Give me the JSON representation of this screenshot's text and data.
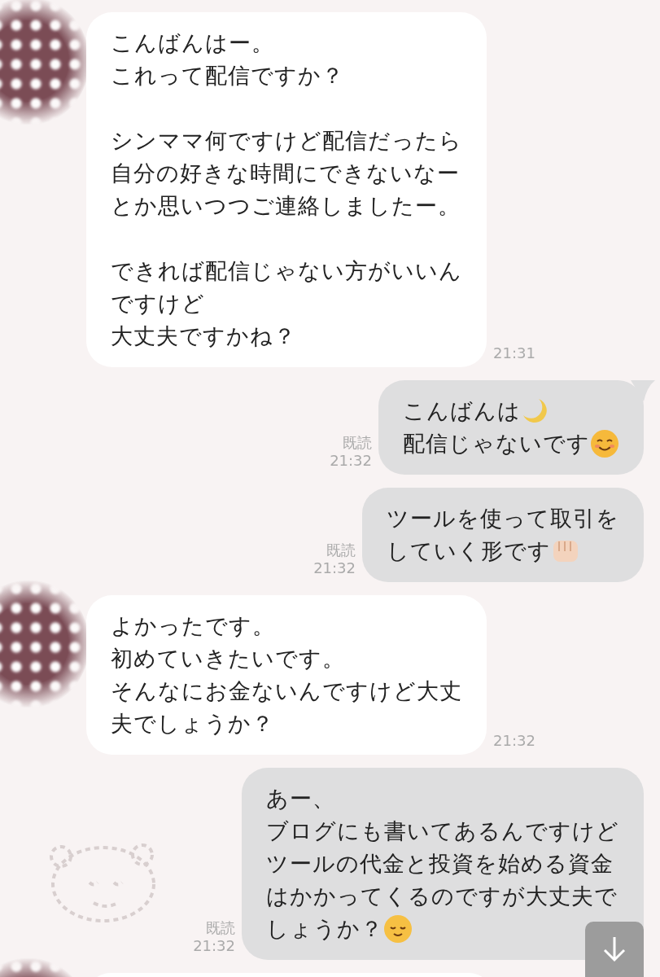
{
  "messages": [
    {
      "kind": "incoming",
      "time": "21:31",
      "paragraphs": [
        [
          {
            "kind": "plain",
            "text": "こんばんはー。"
          },
          {
            "kind": "plain",
            "text": "これって配信ですか？"
          }
        ],
        [
          {
            "kind": "plain",
            "text": "シンママ何ですけど配信だったら"
          },
          {
            "kind": "plain",
            "text": "自分の好きな時間にできないなー"
          },
          {
            "kind": "plain",
            "text": "とか思いつつご連絡しましたー。"
          }
        ],
        [
          {
            "kind": "plain",
            "text": "できれば配信じゃない方がいいん"
          },
          {
            "kind": "plain",
            "text": "ですけど"
          },
          {
            "kind": "plain",
            "text": "大丈夫ですかね？"
          }
        ]
      ]
    },
    {
      "kind": "outgoing",
      "tail": true,
      "read_label": "既読",
      "time": "21:32",
      "paragraphs": [
        [
          {
            "kind": "moon",
            "text": "こんばんは"
          },
          {
            "kind": "smile",
            "text": "配信じゃないです"
          }
        ]
      ]
    },
    {
      "kind": "outgoing",
      "tail": false,
      "read_label": "既読",
      "time": "21:32",
      "paragraphs": [
        [
          {
            "kind": "plain",
            "text": "ツールを使って取引を"
          },
          {
            "kind": "fist",
            "text": "していく形です"
          }
        ]
      ]
    },
    {
      "kind": "incoming",
      "time": "21:32",
      "paragraphs": [
        [
          {
            "kind": "plain",
            "text": "よかったです。"
          },
          {
            "kind": "plain",
            "text": "初めていきたいです。"
          },
          {
            "kind": "plain",
            "text": "そんなにお金ないんですけど大丈"
          },
          {
            "kind": "plain",
            "text": "夫でしょうか？"
          }
        ]
      ]
    },
    {
      "kind": "outgoing",
      "tail": false,
      "sticker": true,
      "read_label": "既読",
      "time": "21:32",
      "paragraphs": [
        [
          {
            "kind": "plain",
            "text": "あー、"
          },
          {
            "kind": "plain",
            "text": "ブログにも書いてあるんですけど"
          },
          {
            "kind": "plain",
            "text": "ツールの代金と投資を始める資金"
          },
          {
            "kind": "plain",
            "text": "はかかってくるのですが大丈夫で"
          },
          {
            "kind": "relieved",
            "text": "しょうか？"
          }
        ]
      ]
    },
    {
      "kind": "partial"
    }
  ]
}
